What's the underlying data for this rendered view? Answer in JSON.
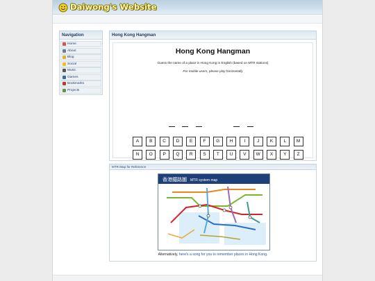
{
  "site": {
    "title": "Daiwong's Website"
  },
  "nav": {
    "heading": "Navigation",
    "items": [
      {
        "label": "Home",
        "icon": "home-icon",
        "color": "#d9534f"
      },
      {
        "label": "About",
        "icon": "info-icon",
        "color": "#6a7f96"
      },
      {
        "label": "Blog",
        "icon": "notepad-icon",
        "color": "#e0b030"
      },
      {
        "label": "Social",
        "icon": "smiley-icon",
        "color": "#f0c020"
      },
      {
        "label": "Music",
        "icon": "speaker-icon",
        "color": "#555555"
      },
      {
        "label": "Games",
        "icon": "globe-icon",
        "color": "#3a6a9a"
      },
      {
        "label": "Bookmarks",
        "icon": "bookmark-icon",
        "color": "#c0392b"
      },
      {
        "label": "Projects",
        "icon": "projects-icon",
        "color": "#5a9a3a"
      }
    ]
  },
  "game_panel": {
    "heading": "Hong Kong Hangman",
    "title": "Hong Kong Hangman",
    "instructions": "Guess the name of a place in Hong Kong in English (based on MTR stations)",
    "mobile_note": "For mobile users, please play horizontally",
    "blank_count": 5,
    "keys_row1": [
      "A",
      "B",
      "C",
      "D",
      "E",
      "F",
      "G",
      "H",
      "I",
      "J",
      "K",
      "L",
      "M"
    ],
    "keys_row2": [
      "N",
      "O",
      "P",
      "Q",
      "R",
      "S",
      "T",
      "U",
      "V",
      "W",
      "X",
      "Y",
      "Z"
    ]
  },
  "map_panel": {
    "heading": "MTR Map for Reference",
    "map_title_cn": "香港鐵路圖",
    "map_title_en": "MTR system map",
    "caption_prefix": "Alternatively, ",
    "caption_link": "here's a song for you to remember places in Hong Kong",
    "caption_suffix": "."
  },
  "colors": {
    "accent": "#1d3a5a",
    "link": "#2255aa"
  }
}
